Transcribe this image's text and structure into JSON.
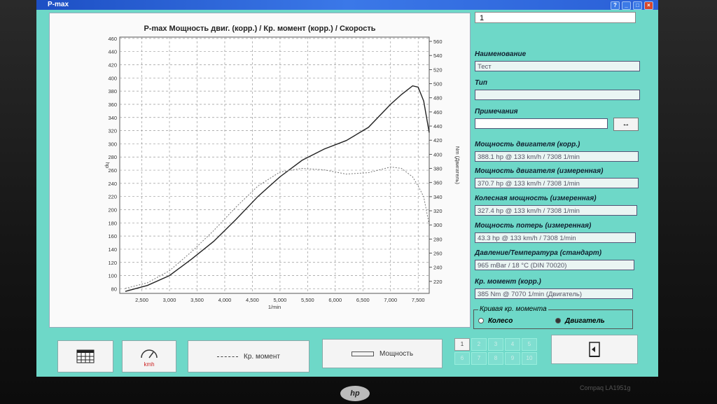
{
  "window": {
    "title": "P-max"
  },
  "top_input": {
    "value": "1"
  },
  "chart": {
    "title": "P-max Мощность двиг. (корр.) / Кр. момент (корр.) / Скорость",
    "ylabel_left": "hp",
    "ylabel_right": "Nm (Двигатель)",
    "xlabel": "1/min",
    "y_left_ticks": [
      "460",
      "440",
      "420",
      "400",
      "380",
      "360",
      "340",
      "320",
      "300",
      "280",
      "260",
      "240",
      "220",
      "200",
      "180",
      "160",
      "140",
      "120",
      "100",
      "80"
    ],
    "y_right_ticks": [
      "560",
      "540",
      "520",
      "500",
      "480",
      "460",
      "440",
      "420",
      "400",
      "380",
      "360",
      "340",
      "320",
      "300",
      "280",
      "260",
      "240",
      "220"
    ],
    "x_ticks": [
      "2,500",
      "3,000",
      "3,500",
      "4,000",
      "4,500",
      "5,000",
      "5,500",
      "6,000",
      "6,500",
      "7,000",
      "7,500"
    ]
  },
  "chart_data": {
    "type": "line",
    "title": "P-max Мощность двиг. (корр.) / Кр. момент (корр.) / Скорость",
    "xlabel": "1/min",
    "ylabel": "hp",
    "ylabel_right": "Nm (Двигатель)",
    "xlim": [
      2100,
      7700
    ],
    "ylim": [
      73,
      462
    ],
    "ylim_right": [
      203,
      566
    ],
    "grid": true,
    "series": [
      {
        "name": "Мощность",
        "axis": "left",
        "style": "solid",
        "x": [
          2200,
          2600,
          3000,
          3400,
          3800,
          4200,
          4600,
          5000,
          5400,
          5800,
          6200,
          6600,
          7000,
          7200,
          7400,
          7500,
          7600,
          7700
        ],
        "y": [
          76,
          85,
          100,
          125,
          152,
          185,
          220,
          250,
          275,
          292,
          305,
          325,
          360,
          375,
          388,
          386,
          365,
          317
        ]
      },
      {
        "name": "Кр. момент",
        "axis": "right",
        "style": "dotted",
        "x": [
          2200,
          2600,
          3000,
          3400,
          3800,
          4200,
          4600,
          5000,
          5400,
          5800,
          6200,
          6600,
          7000,
          7200,
          7400,
          7500,
          7600,
          7700
        ],
        "y": [
          210,
          218,
          235,
          262,
          292,
          325,
          355,
          375,
          380,
          378,
          372,
          374,
          382,
          380,
          368,
          355,
          340,
          300
        ]
      }
    ]
  },
  "fields": {
    "name_label": "Наименование",
    "name_value": "Тест",
    "type_label": "Тип",
    "type_value": "",
    "notes_label": "Примечания",
    "notes_value": "",
    "power_corr_label": "Мощность двигателя (корр.)",
    "power_corr_value": "388.1 hp @ 133 km/h / 7308 1/min",
    "power_meas_label": "Мощность двигателя (измеренная)",
    "power_meas_value": "370.7 hp @ 133 km/h / 7308 1/min",
    "wheel_power_label": "Колесная мощность (измеренная)",
    "wheel_power_value": "327.4 hp @ 133 km/h / 7308 1/min",
    "loss_power_label": "Мощность потерь (измеренная)",
    "loss_power_value": "43.3 hp @ 133 km/h / 7308 1/min",
    "pressure_label": "Давление/Температура (стандарт)",
    "pressure_value": "965 mBar / 18 °C (DIN 70020)",
    "torque_label": "Кр. момент (корр.)",
    "torque_value": "385 Nm @ 7070 1/min (Двигатель)"
  },
  "torque_curve_group": {
    "legend": "Кривая кр. момента",
    "option_wheel": "Колесо",
    "option_engine": "Двигатель",
    "selected": "Двигатель"
  },
  "arrow_button": {
    "label": "↔"
  },
  "bottom": {
    "speed_unit": "kmh",
    "torque_button": "Кр. момент",
    "power_button": "Мощность",
    "numbers_top": [
      "1",
      "2",
      "3",
      "4",
      "5"
    ],
    "numbers_bottom": [
      "6",
      "7",
      "8",
      "9",
      "10"
    ]
  },
  "monitor": {
    "brand": "hp",
    "model": "Compaq  LA1951g"
  }
}
